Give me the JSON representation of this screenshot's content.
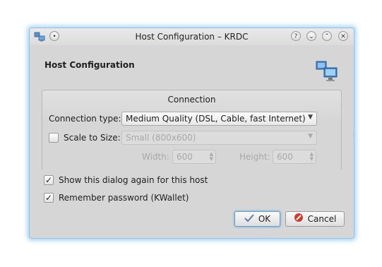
{
  "window": {
    "title": "Host Configuration – KRDC",
    "buttons": [
      "help-icon",
      "minimize-icon",
      "maximize-icon",
      "close-icon"
    ]
  },
  "header": {
    "title": "Host Configuration",
    "icon": "remote-desktop-icon"
  },
  "connection": {
    "group_title": "Connection",
    "type_label": "Connection type:",
    "type_value": "Medium Quality (DSL, Cable, fast Internet)",
    "scale_label": "Scale to Size:",
    "scale_checked": false,
    "scale_value": "Small (800x600)",
    "width_label": "Width:",
    "width_value": "600",
    "height_label": "Height:",
    "height_value": "600"
  },
  "options": {
    "show_again_label": "Show this dialog again for this host",
    "show_again_checked": true,
    "remember_label": "Remember password (KWallet)",
    "remember_checked": true
  },
  "buttons": {
    "ok": "OK",
    "cancel": "Cancel"
  },
  "colors": {
    "window_glow": "#6eb9eb",
    "cancel_icon": "#d23a2e",
    "ok_accent": "#5f9fd6"
  }
}
